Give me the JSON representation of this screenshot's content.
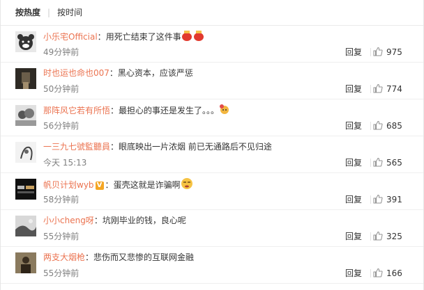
{
  "sort": {
    "hot_label": "按热度",
    "time_label": "按时间"
  },
  "comments": [
    {
      "user": "小乐宅Official",
      "text": "用死亡结束了这件事",
      "emoji": "red-pot-emoji",
      "verified": false,
      "time": "49分钟前",
      "reply": "回复",
      "likes": "975",
      "avatar_icon": "bear-avatar"
    },
    {
      "user": "时也运也命也007",
      "text": "黑心资本，应该严惩",
      "emoji": "",
      "verified": false,
      "time": "50分钟前",
      "reply": "回复",
      "likes": "774",
      "avatar_icon": "dark-photo-avatar"
    },
    {
      "user": "那阵风它若有所悟",
      "text": "最担心的事还是发生了。。。",
      "emoji": "face-badge-emoji",
      "verified": false,
      "time": "56分钟前",
      "reply": "回复",
      "likes": "685",
      "avatar_icon": "bw-photo-avatar"
    },
    {
      "user": "一三九七號監聽員",
      "text": "眼底映出一片浓烟 前已无通路后不见归途",
      "emoji": "",
      "verified": false,
      "time": "今天 15:13",
      "reply": "回复",
      "likes": "565",
      "avatar_icon": "sketch-avatar"
    },
    {
      "user": "帆贝计划wyb",
      "text": "蛋壳这就是诈骗啊",
      "emoji": "tired-face-emoji",
      "verified": true,
      "time": "58分钟前",
      "reply": "回复",
      "likes": "391",
      "avatar_icon": "text-logo-avatar"
    },
    {
      "user": "小小cheng呀",
      "text": "坑刚毕业的钱，良心呢",
      "emoji": "",
      "verified": false,
      "time": "55分钟前",
      "reply": "回复",
      "likes": "325",
      "avatar_icon": "landscape-avatar"
    },
    {
      "user": "两支大烟枪",
      "text": "悲伤而又悲惨的互联网金融",
      "emoji": "",
      "verified": false,
      "time": "55分钟前",
      "reply": "回复",
      "likes": "166",
      "avatar_icon": "person-photo-avatar"
    }
  ],
  "colors": {
    "username": "#eb7350",
    "text": "#333333",
    "time": "#808080",
    "divider": "#efefef"
  }
}
